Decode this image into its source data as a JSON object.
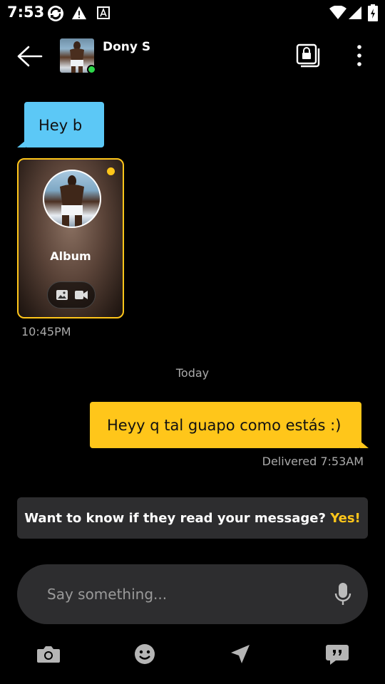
{
  "status_bar": {
    "time": "7:53"
  },
  "header": {
    "contact_name": "Dony S",
    "online": true
  },
  "messages": {
    "incoming_text": "Hey b",
    "album": {
      "label": "Album"
    },
    "incoming_time": "10:45PM",
    "day_separator": "Today",
    "outgoing_text": "Heyy q tal guapo como estás :)",
    "outgoing_status": "Delivered 7:53AM"
  },
  "read_banner": {
    "question": "Want to know if they read your message?",
    "action": "Yes!"
  },
  "composer": {
    "placeholder": "Say something..."
  },
  "icons": {
    "back": "arrow-left-icon",
    "album": "private-album-icon",
    "more": "more-vert-icon",
    "camera": "camera-icon",
    "emoji": "emoji-icon",
    "location": "location-arrow-icon",
    "phrases": "saved-phrases-icon",
    "mic": "microphone-icon"
  },
  "colors": {
    "accent": "#ffc61a",
    "incoming_bubble": "#5cc8f6",
    "online": "#2dd84a",
    "surface": "#2d2d2f"
  }
}
